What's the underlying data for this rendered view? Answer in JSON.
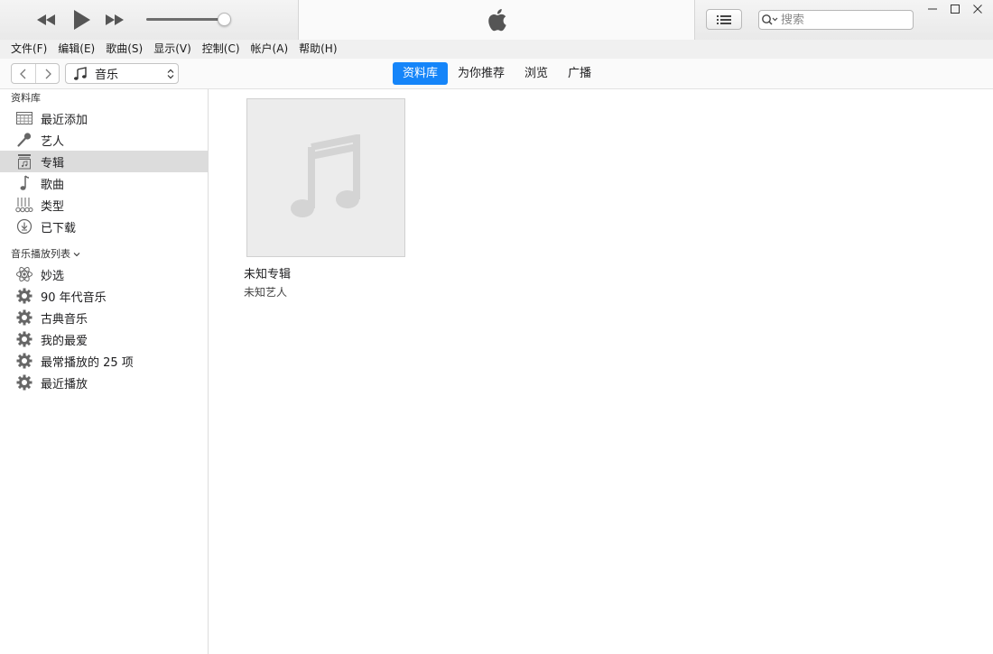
{
  "player": {
    "volume_percent": 92,
    "search_placeholder": "搜索"
  },
  "menu": [
    "文件(F)",
    "编辑(E)",
    "歌曲(S)",
    "显示(V)",
    "控制(C)",
    "帐户(A)",
    "帮助(H)"
  ],
  "nav": {
    "media_type": "音乐",
    "tabs": [
      {
        "label": "资料库",
        "active": true
      },
      {
        "label": "为你推荐",
        "active": false
      },
      {
        "label": "浏览",
        "active": false
      },
      {
        "label": "广播",
        "active": false
      }
    ]
  },
  "sidebar": {
    "library_title": "资料库",
    "library_items": [
      {
        "label": "最近添加",
        "icon": "grid-icon"
      },
      {
        "label": "艺人",
        "icon": "microphone-icon"
      },
      {
        "label": "专辑",
        "icon": "album-icon",
        "selected": true
      },
      {
        "label": "歌曲",
        "icon": "music-note-icon"
      },
      {
        "label": "类型",
        "icon": "genre-icon"
      },
      {
        "label": "已下载",
        "icon": "download-icon"
      }
    ],
    "playlists_title": "音乐播放列表",
    "playlist_items": [
      {
        "label": "妙选",
        "icon": "genius-icon"
      },
      {
        "label": "90 年代音乐",
        "icon": "smart-playlist-gear-icon"
      },
      {
        "label": "古典音乐",
        "icon": "smart-playlist-gear-icon"
      },
      {
        "label": "我的最爱",
        "icon": "smart-playlist-gear-icon"
      },
      {
        "label": "最常播放的 25 项",
        "icon": "smart-playlist-gear-icon"
      },
      {
        "label": "最近播放",
        "icon": "smart-playlist-gear-icon"
      }
    ]
  },
  "albums": [
    {
      "title": "未知专辑",
      "artist": "未知艺人"
    }
  ],
  "colors": {
    "accent": "#1585f9",
    "selected_row": "#dcdcdc"
  }
}
